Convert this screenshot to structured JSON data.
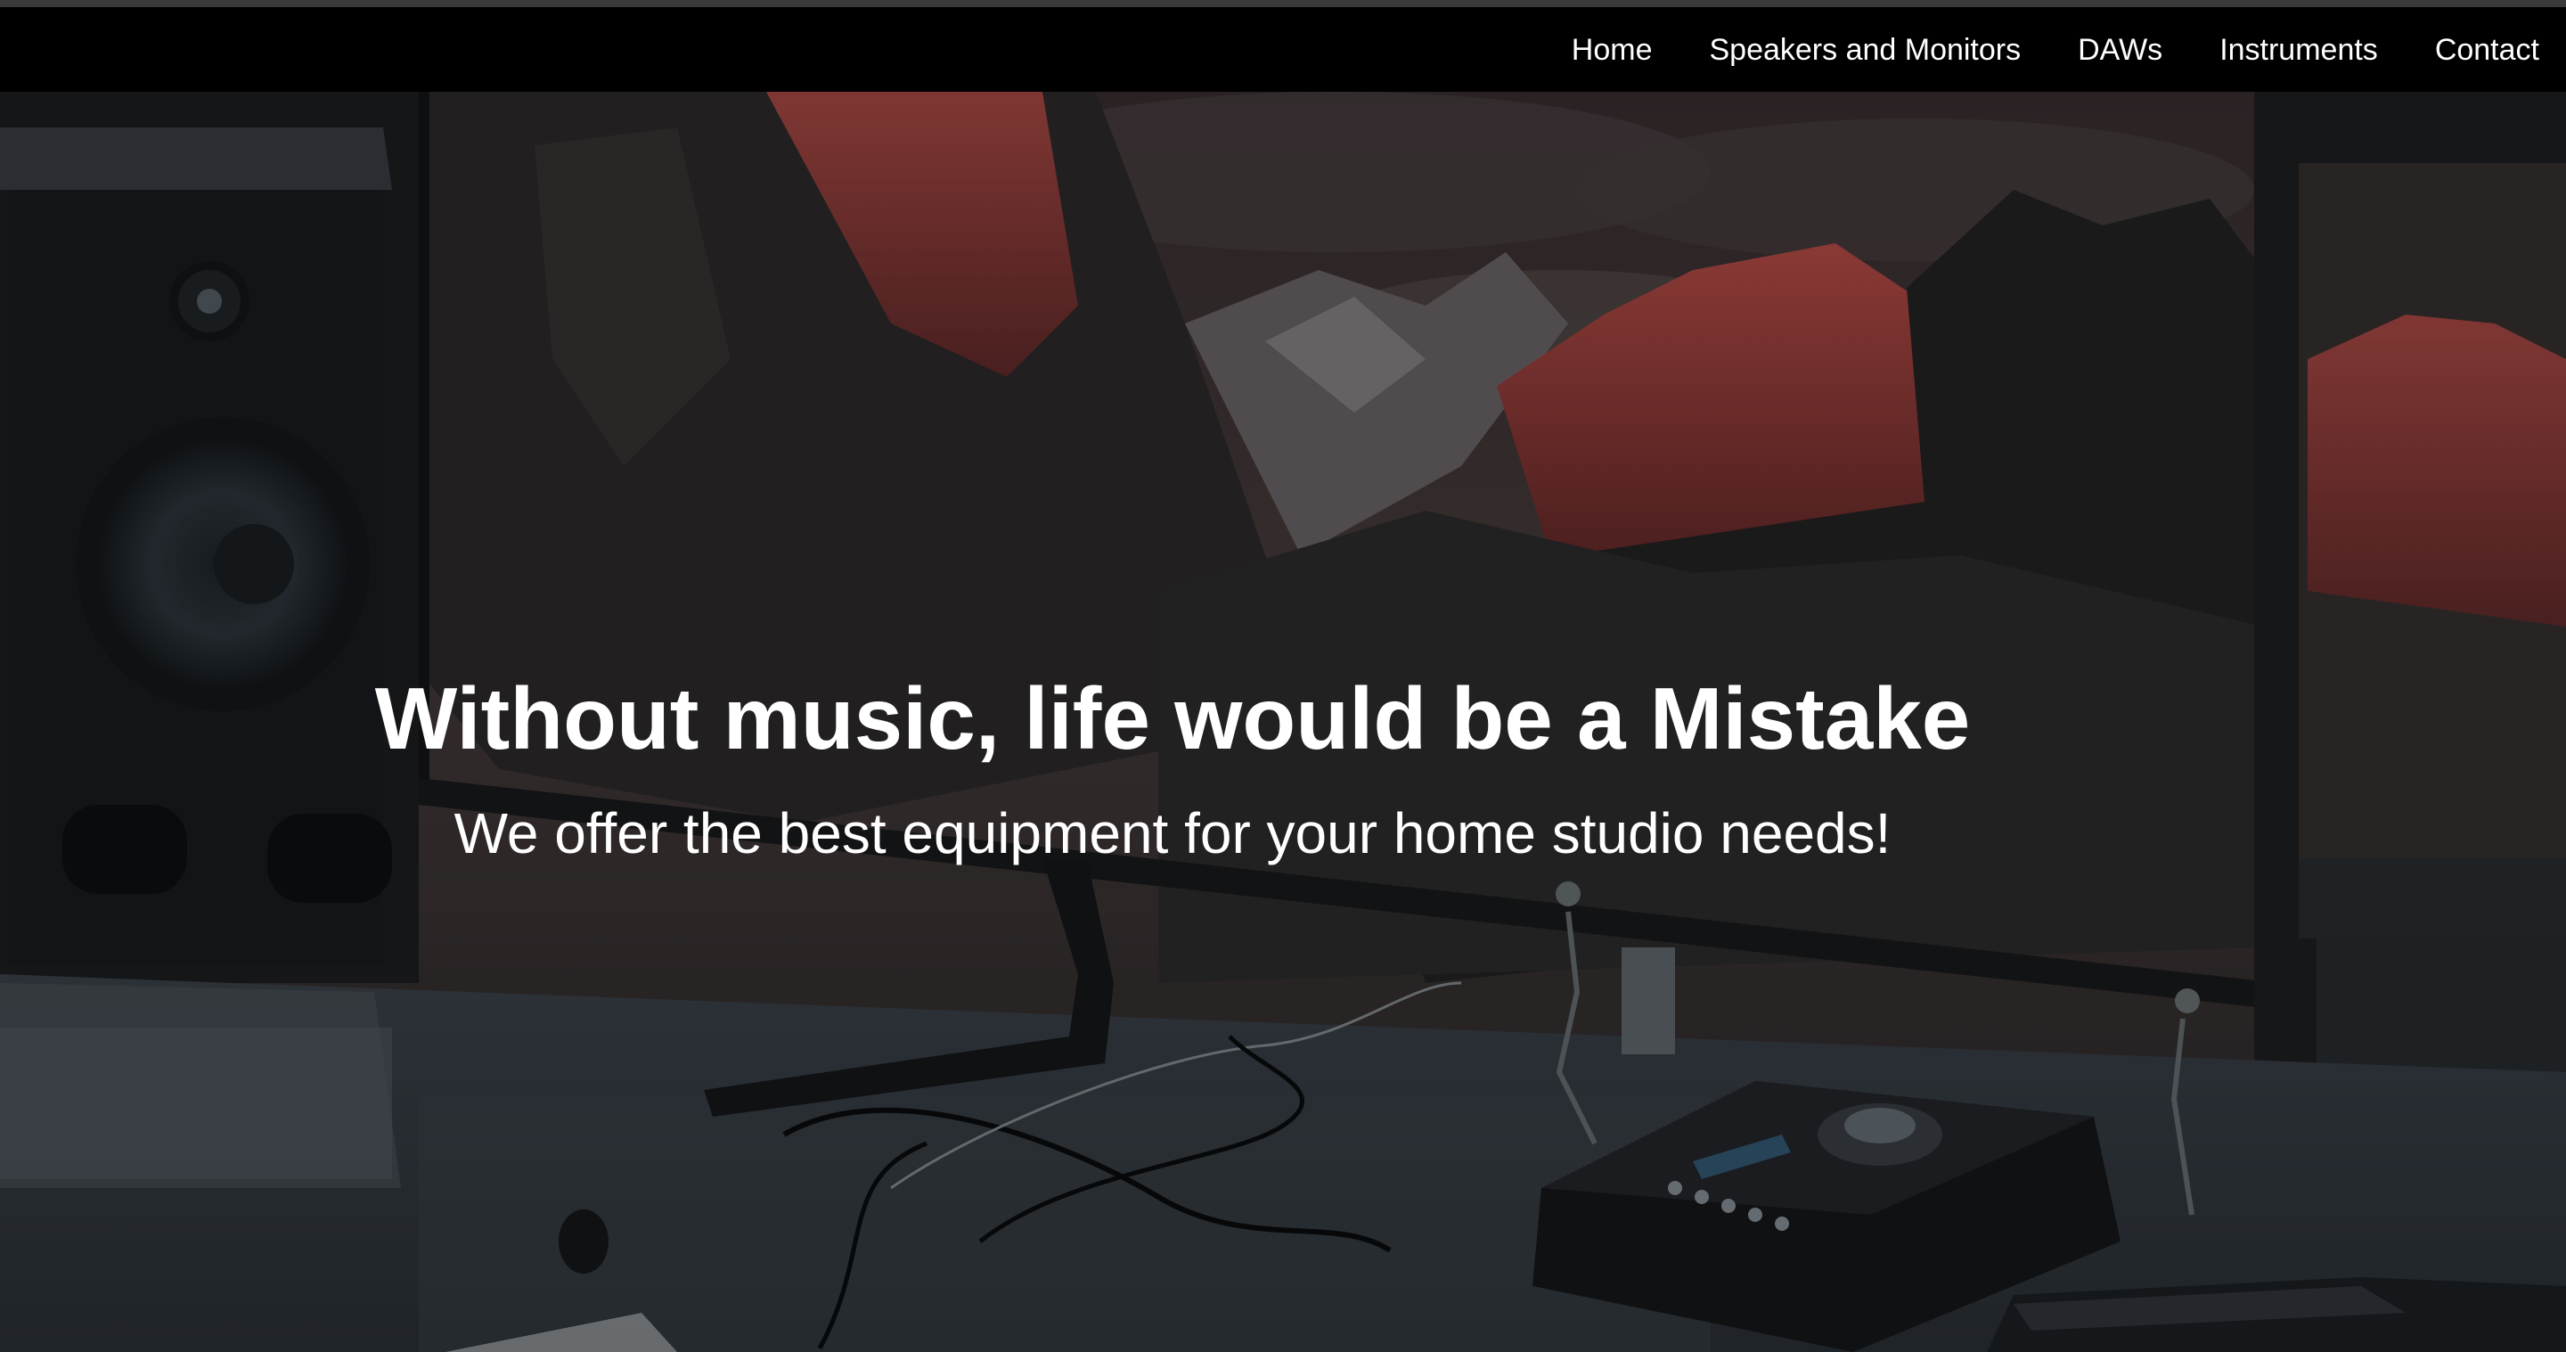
{
  "nav": {
    "items": [
      {
        "label": "Home"
      },
      {
        "label": "Speakers and Monitors"
      },
      {
        "label": "DAWs"
      },
      {
        "label": "Instruments"
      },
      {
        "label": "Contact"
      }
    ]
  },
  "hero": {
    "title": "Without music, life would be a Mistake",
    "subtitle": "We offer the best equipment for your home studio needs!"
  },
  "colors": {
    "navbar_bg": "#000000",
    "text": "#ffffff",
    "mountain_accent": "#b6453f"
  }
}
